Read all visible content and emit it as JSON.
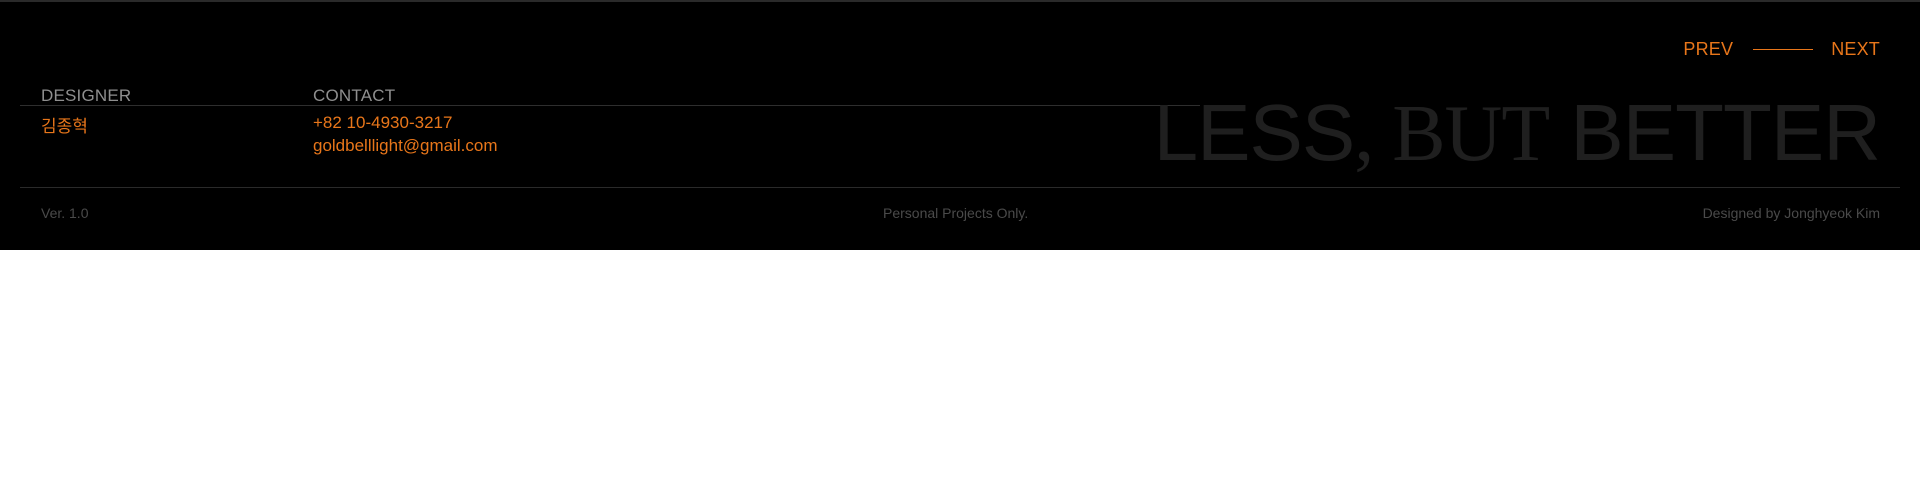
{
  "nav": {
    "prev_label": "PREV",
    "next_label": "NEXT"
  },
  "designer": {
    "label": "DESIGNER",
    "name": "김종혁"
  },
  "contact": {
    "label": "CONTACT",
    "phone": "+82 10-4930-3217",
    "email": "goldbelllight@gmail.com"
  },
  "tagline": {
    "part1": "LESS",
    "comma": ",",
    "part2": " BUT",
    "part3": " BETTER"
  },
  "meta": {
    "version": "Ver. 1.0",
    "notice": "Personal Projects Only.",
    "credit": "Designed by Jonghyeok Kim"
  },
  "colors": {
    "accent": "#e8761a",
    "background": "#000000",
    "muted_text": "#8f8f8f",
    "tagline": "#1f1f1f"
  }
}
